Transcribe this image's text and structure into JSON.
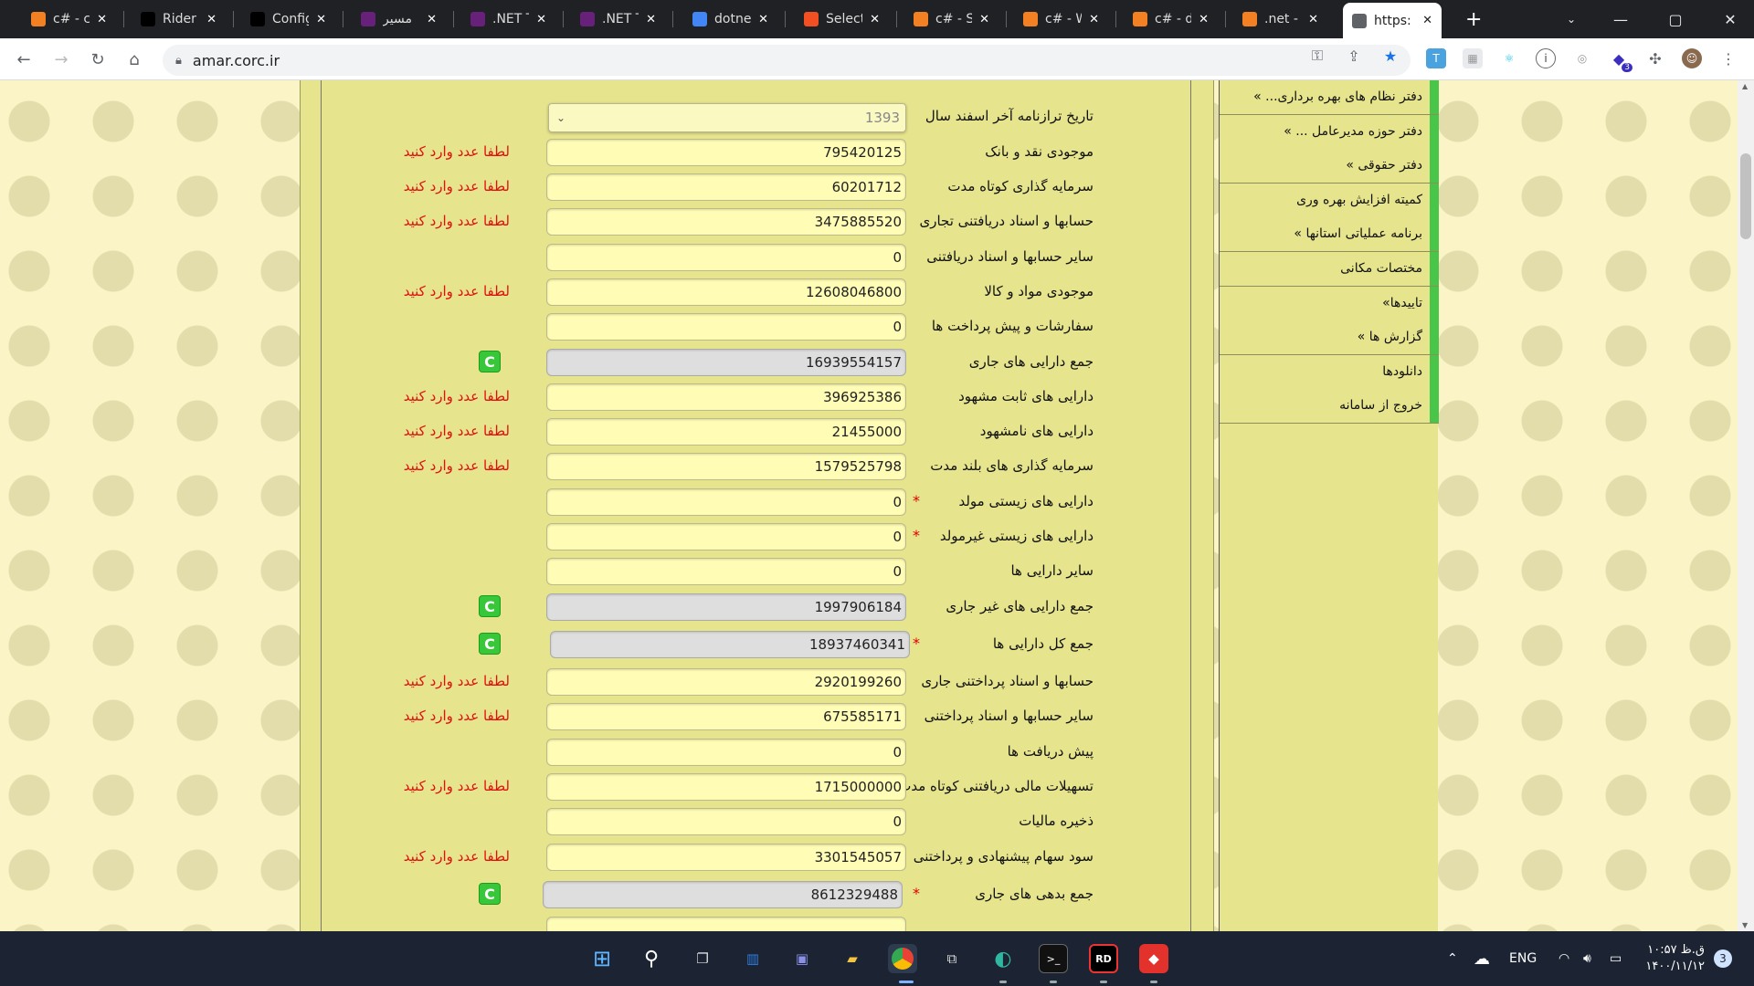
{
  "browser": {
    "tabs": [
      {
        "title": "c# - cl",
        "icon": "stackoverflow-icon",
        "color": "#f48024"
      },
      {
        "title": "Rider",
        "icon": "jetbrains-icon",
        "color": "#000000"
      },
      {
        "title": "Config",
        "icon": "jetbrains-icon",
        "color": "#000000"
      },
      {
        "title": "مسیر",
        "icon": "visual-studio-icon",
        "color": "#68217a"
      },
      {
        "title": ".NET T",
        "icon": "visual-studio-icon",
        "color": "#68217a"
      },
      {
        "title": ".NET T",
        "icon": "visual-studio-icon",
        "color": "#68217a"
      },
      {
        "title": "dotne",
        "icon": "google-icon",
        "color": "#4285f4"
      },
      {
        "title": "Select",
        "icon": "microsoft-icon",
        "color": "#f25022"
      },
      {
        "title": "c# - S",
        "icon": "stackoverflow-icon",
        "color": "#f48024"
      },
      {
        "title": "c# - W",
        "icon": "stackoverflow-icon",
        "color": "#f48024"
      },
      {
        "title": "c# - d",
        "icon": "stackoverflow-icon",
        "color": "#f48024"
      },
      {
        "title": ".net -",
        "icon": "stackoverflow-icon",
        "color": "#f48024"
      },
      {
        "title": "https:",
        "icon": "globe-icon",
        "color": "#5f6368",
        "active": true
      }
    ],
    "new_tab": "+",
    "url": "amar.corc.ir",
    "window_controls": {
      "minimize": "—",
      "maximize": "▢",
      "close": "✕"
    },
    "extension_badge": "3"
  },
  "form": {
    "rows": [
      {
        "label": "تاریخ ترازنامه آخر اسفند سال",
        "value": "1393",
        "type": "select",
        "required": false,
        "error": "",
        "calc": false
      },
      {
        "label": "موجودی نقد و بانک",
        "value": "795420125",
        "required": false,
        "error": "لطفا عدد وارد کنید",
        "calc": false
      },
      {
        "label": "سرمایه گذاری کوتاه مدت",
        "value": "60201712",
        "required": false,
        "error": "لطفا عدد وارد کنید",
        "calc": false
      },
      {
        "label": "حسابها و اسناد دریافتنی تجاری",
        "value": "3475885520",
        "required": false,
        "error": "لطفا عدد وارد کنید",
        "calc": false
      },
      {
        "label": "سایر حسابها و اسناد دریافتنی",
        "value": "0",
        "required": false,
        "error": "",
        "calc": false
      },
      {
        "label": "موجودی مواد و کالا",
        "value": "12608046800",
        "required": false,
        "error": "لطفا عدد وارد کنید",
        "calc": false
      },
      {
        "label": "سفارشات و پیش پرداخت ها",
        "value": "0",
        "required": false,
        "error": "",
        "calc": false
      },
      {
        "label": "جمع دارایی های جاری",
        "value": "16939554157",
        "required": false,
        "error": "",
        "calc": true
      },
      {
        "label": "دارایی های ثابت مشهود",
        "value": "396925386",
        "required": false,
        "error": "لطفا عدد وارد کنید",
        "calc": false
      },
      {
        "label": "دارایی های نامشهود",
        "value": "21455000",
        "required": false,
        "error": "لطفا عدد وارد کنید",
        "calc": false
      },
      {
        "label": "سرمایه گذاری های بلند مدت",
        "value": "1579525798",
        "required": false,
        "error": "لطفا عدد وارد کنید",
        "calc": false
      },
      {
        "label": "دارایی های زیستی مولد",
        "value": "0",
        "required": true,
        "error": "",
        "calc": false
      },
      {
        "label": "دارایی های زیستی غیرمولد",
        "value": "0",
        "required": true,
        "error": "",
        "calc": false
      },
      {
        "label": "سایر دارایی ها",
        "value": "0",
        "required": false,
        "error": "",
        "calc": false
      },
      {
        "label": "جمع دارایی های غیر جاری",
        "value": "1997906184",
        "required": false,
        "error": "",
        "calc": true
      },
      {
        "label": "جمع کل دارایی ها",
        "value": "18937460341",
        "required": true,
        "error": "",
        "calc": true
      },
      {
        "label": "حسابها و اسناد پرداختنی جاری",
        "value": "2920199260",
        "required": false,
        "error": "لطفا عدد وارد کنید",
        "calc": false
      },
      {
        "label": "سایر حسابها و اسناد پرداختنی",
        "value": "675585171",
        "required": false,
        "error": "لطفا عدد وارد کنید",
        "calc": false
      },
      {
        "label": "پیش دریافت ها",
        "value": "0",
        "required": false,
        "error": "",
        "calc": false
      },
      {
        "label": "تسهیلات مالی دریافتنی کوتاه مدت",
        "value": "1715000000",
        "required": false,
        "error": "لطفا عدد وارد کنید",
        "calc": false
      },
      {
        "label": "ذخیره مالیات",
        "value": "0",
        "required": false,
        "error": "",
        "calc": false
      },
      {
        "label": "سود سهام پیشنهادی و پرداختنی",
        "value": "3301545057",
        "required": false,
        "error": "لطفا عدد وارد کنید",
        "calc": false
      },
      {
        "label": "جمع بدهی های جاری",
        "value": "8612329488",
        "required": true,
        "error": "",
        "calc": true
      }
    ],
    "required_mark": "*",
    "refresh_glyph": "C"
  },
  "sidebar": {
    "items": [
      "دفتر نظام های بهره برداری... »",
      "دفتر حوزه مدیرعامل ... »",
      "دفتر حقوقی »",
      "کمیته افزایش بهره وری",
      "برنامه عملیاتی استانها »",
      "مختصات مکانی",
      "تاییدها»",
      "گزارش ها »",
      "دانلودها",
      "خروج از سامانه"
    ]
  },
  "taskbar": {
    "lang": "ENG",
    "time": "۱۰:۵۷ ق.ظ",
    "date": "۱۴۰۰/۱۱/۱۲",
    "notifications": "3"
  },
  "colors": {
    "page_bg": "#fbf4c6",
    "panel": "#e6e48c",
    "input": "#fffcb5",
    "error": "#e01010",
    "menu_accent": "#49c649"
  }
}
